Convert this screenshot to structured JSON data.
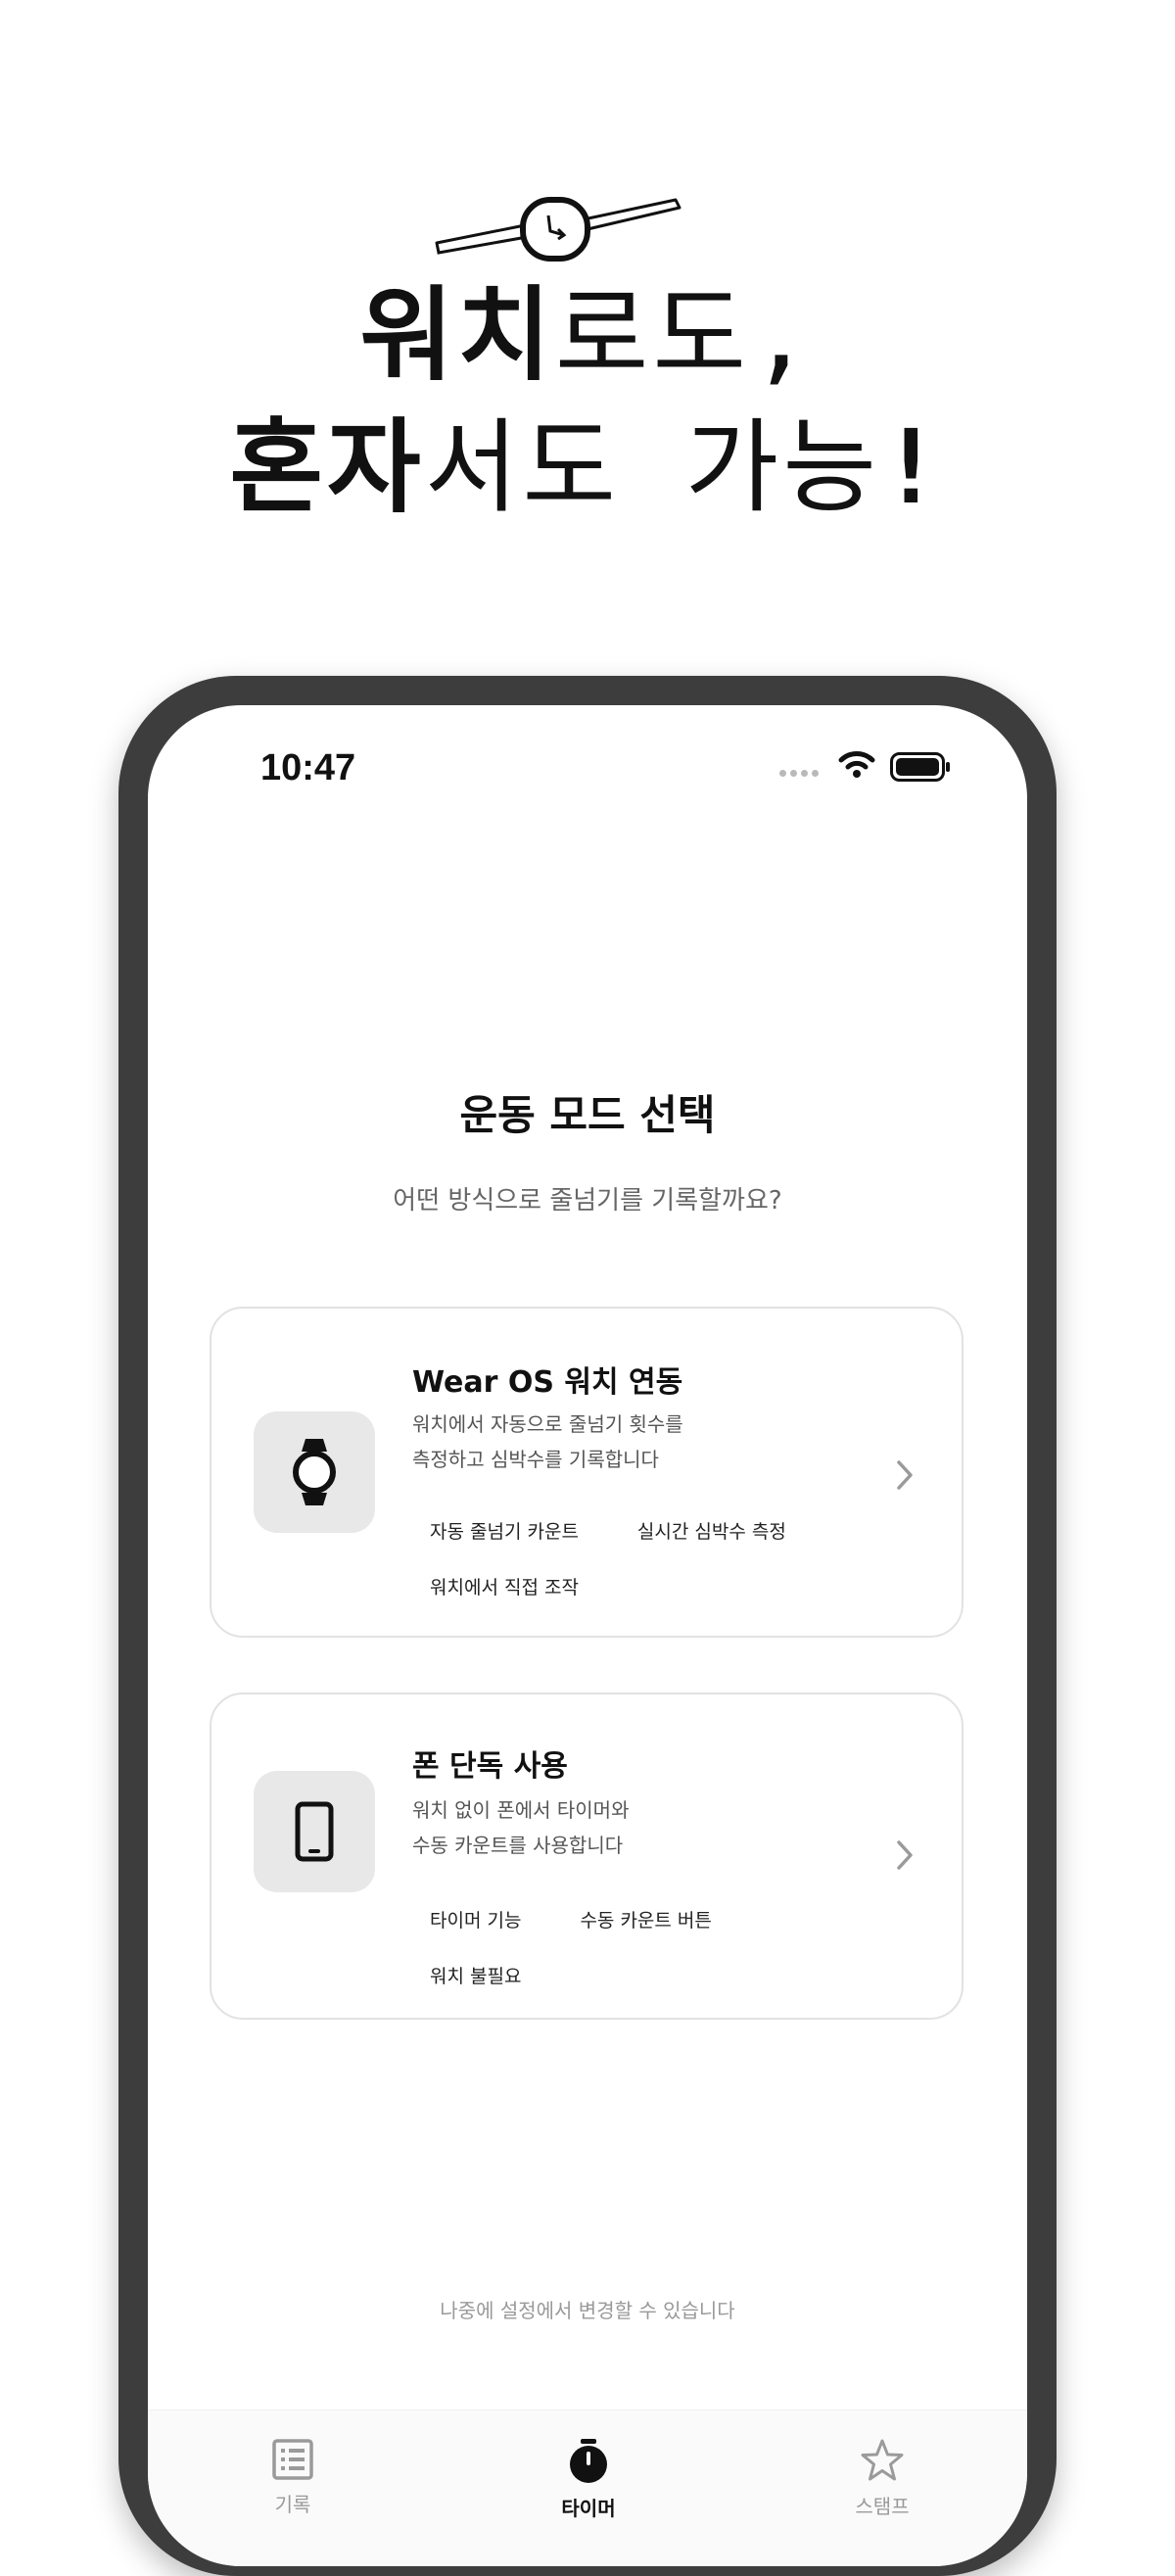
{
  "promo": {
    "line1_bold": "워치",
    "line1_light": "로도,",
    "line2_bold": "혼자",
    "line2_light": "서도 가능",
    "line2_bang": "!"
  },
  "status_bar": {
    "time": "10:47"
  },
  "mode_select": {
    "title": "운동 모드 선택",
    "subtitle": "어떤 방식으로 줄넘기를 기록할까요?"
  },
  "cards": [
    {
      "icon": "watch-icon",
      "title": "Wear OS 워치 연동",
      "desc_line1": "워치에서 자동으로 줄넘기 횟수를",
      "desc_line2": "측정하고 심박수를 기록합니다",
      "tags": [
        "자동 줄넘기 카운트",
        "실시간 심박수 측정",
        "워치에서 직접 조작"
      ]
    },
    {
      "icon": "smartphone-icon",
      "title": "폰 단독 사용",
      "desc_line1": "워치 없이 폰에서 타이머와",
      "desc_line2": "수동 카운트를 사용합니다",
      "tags": [
        "타이머 기능",
        "수동 카운트 버튼",
        "워치 불필요"
      ]
    }
  ],
  "footer_note": "나중에 설정에서 변경할 수 있습니다",
  "tab_bar": {
    "tabs": [
      {
        "label": "기록",
        "icon": "list-icon",
        "active": false
      },
      {
        "label": "타이머",
        "icon": "stopwatch-icon",
        "active": true
      },
      {
        "label": "스탬프",
        "icon": "star-icon",
        "active": false
      }
    ]
  },
  "colors": {
    "frame": "#3d3d3d",
    "icon_box": "#e8e8e8",
    "card_border": "#e2e2e2",
    "muted_text": "#999999"
  }
}
